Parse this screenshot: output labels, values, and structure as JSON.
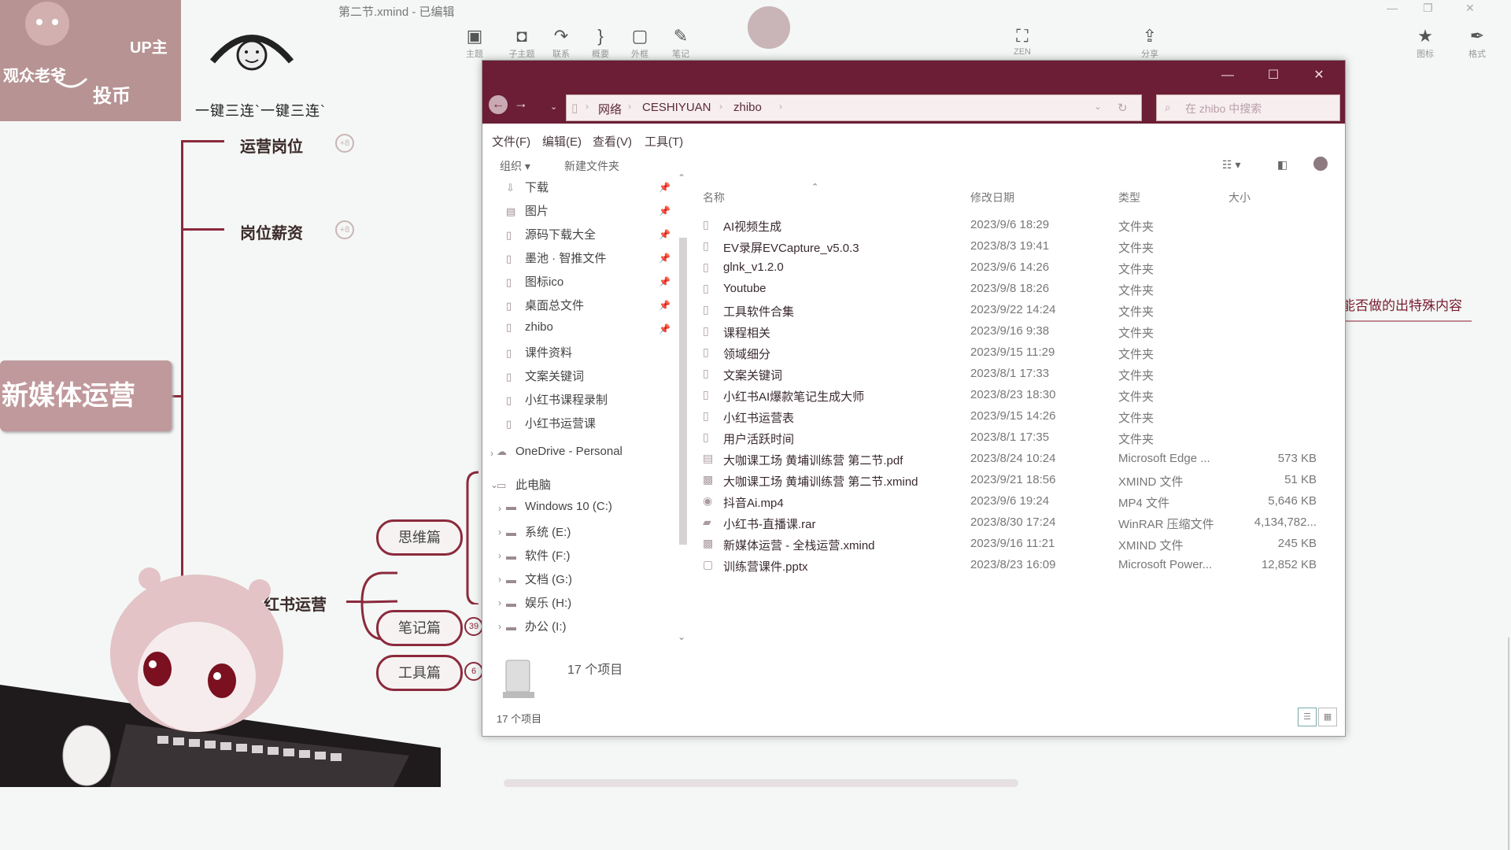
{
  "xmind": {
    "title": "第二节.xmind - 已编辑",
    "toolbar": [
      {
        "label": "主题",
        "icon": "topic-icon"
      },
      {
        "label": "子主题",
        "icon": "subtopic-icon"
      },
      {
        "label": "联系",
        "icon": "relationship-icon"
      },
      {
        "label": "概要",
        "icon": "summary-icon"
      },
      {
        "label": "外框",
        "icon": "boundary-icon"
      },
      {
        "label": "笔记",
        "icon": "note-icon"
      },
      {
        "label": "ZEN",
        "icon": "zen-icon"
      },
      {
        "label": "分享",
        "icon": "share-icon"
      },
      {
        "label": "图标",
        "icon": "star-icon"
      },
      {
        "label": "格式",
        "icon": "pen-icon"
      }
    ],
    "stickers": {
      "audience": "观众老爷",
      "up_host": "UP主",
      "coin": "投币",
      "triple": "一键三连`一键三连`"
    },
    "topics": {
      "central": "新媒体运营",
      "job_position": "运营岗位",
      "salary": "岗位薪资",
      "branch": "红书运营",
      "thinking": "思维篇",
      "notes": "笔记篇",
      "tools": "工具篇"
    },
    "badges": {
      "position": "+8",
      "salary": "+8",
      "notes": "39",
      "tools": "6"
    },
    "right_note": "能否做的出特殊内容"
  },
  "explorer": {
    "breadcrumb": [
      "网络",
      "CESHIYUAN",
      "zhibo"
    ],
    "search_placeholder": "在 zhibo 中搜索",
    "menus": [
      "文件(F)",
      "编辑(E)",
      "查看(V)",
      "工具(T)"
    ],
    "commands": {
      "organize": "组织 ▾",
      "new_folder": "新建文件夹"
    },
    "quick_access": [
      {
        "label": "下载",
        "icon": "download-icon",
        "pinned": true
      },
      {
        "label": "图片",
        "icon": "picture-icon",
        "pinned": true
      },
      {
        "label": "源码下载大全",
        "icon": "folder-icon",
        "pinned": true
      },
      {
        "label": "墨池 · 智推文件",
        "icon": "folder-icon",
        "pinned": true
      },
      {
        "label": "图标ico",
        "icon": "folder-icon",
        "pinned": true
      },
      {
        "label": "桌面总文件",
        "icon": "folder-icon",
        "pinned": true
      },
      {
        "label": "zhibo",
        "icon": "folder-icon",
        "pinned": true
      },
      {
        "label": "课件资料",
        "icon": "folder-icon",
        "pinned": false
      },
      {
        "label": "文案关键词",
        "icon": "folder-icon",
        "pinned": false
      },
      {
        "label": "小红书课程录制",
        "icon": "folder-icon",
        "pinned": false
      },
      {
        "label": "小红书运营课",
        "icon": "folder-icon",
        "pinned": false
      }
    ],
    "onedrive": "OneDrive - Personal",
    "this_pc": "此电脑",
    "drives": [
      "Windows 10 (C:)",
      "系统 (E:)",
      "软件 (F:)",
      "文档 (G:)",
      "娱乐 (H:)",
      "办公 (I:)"
    ],
    "columns": {
      "name": "名称",
      "date": "修改日期",
      "type": "类型",
      "size": "大小"
    },
    "files": [
      {
        "name": "AI视频生成",
        "date": "2023/9/6 18:29",
        "type": "文件夹",
        "size": "",
        "icon": "folder-icon"
      },
      {
        "name": "EV录屏EVCapture_v5.0.3",
        "date": "2023/8/3 19:41",
        "type": "文件夹",
        "size": "",
        "icon": "folder-icon"
      },
      {
        "name": "glnk_v1.2.0",
        "date": "2023/9/6 14:26",
        "type": "文件夹",
        "size": "",
        "icon": "folder-icon"
      },
      {
        "name": "Youtube",
        "date": "2023/9/8 18:26",
        "type": "文件夹",
        "size": "",
        "icon": "folder-icon"
      },
      {
        "name": "工具软件合集",
        "date": "2023/9/22 14:24",
        "type": "文件夹",
        "size": "",
        "icon": "folder-icon"
      },
      {
        "name": "课程相关",
        "date": "2023/9/16 9:38",
        "type": "文件夹",
        "size": "",
        "icon": "folder-icon"
      },
      {
        "name": "领域细分",
        "date": "2023/9/15 11:29",
        "type": "文件夹",
        "size": "",
        "icon": "folder-icon"
      },
      {
        "name": "文案关键词",
        "date": "2023/8/1 17:33",
        "type": "文件夹",
        "size": "",
        "icon": "folder-icon"
      },
      {
        "name": "小红书AI爆款笔记生成大师",
        "date": "2023/8/23 18:30",
        "type": "文件夹",
        "size": "",
        "icon": "folder-icon"
      },
      {
        "name": "小红书运营表",
        "date": "2023/9/15 14:26",
        "type": "文件夹",
        "size": "",
        "icon": "folder-icon"
      },
      {
        "name": "用户活跃时间",
        "date": "2023/8/1 17:35",
        "type": "文件夹",
        "size": "",
        "icon": "folder-icon"
      },
      {
        "name": "大咖课工场 黄埔训练营 第二节.pdf",
        "date": "2023/8/24 10:24",
        "type": "Microsoft Edge ...",
        "size": "573 KB",
        "icon": "pdf-icon"
      },
      {
        "name": "大咖课工场 黄埔训练营 第二节.xmind",
        "date": "2023/9/21 18:56",
        "type": "XMIND 文件",
        "size": "51 KB",
        "icon": "xmind-icon"
      },
      {
        "name": "抖音Ai.mp4",
        "date": "2023/9/6 19:24",
        "type": "MP4 文件",
        "size": "5,646 KB",
        "icon": "video-icon"
      },
      {
        "name": "小红书-直播课.rar",
        "date": "2023/8/30 17:24",
        "type": "WinRAR 压缩文件",
        "size": "4,134,782...",
        "icon": "archive-icon"
      },
      {
        "name": "新媒体运营 - 全栈运营.xmind",
        "date": "2023/9/16 11:21",
        "type": "XMIND 文件",
        "size": "245 KB",
        "icon": "xmind-icon"
      },
      {
        "name": "训练营课件.pptx",
        "date": "2023/8/23 16:09",
        "type": "Microsoft Power...",
        "size": "12,852 KB",
        "icon": "file-icon"
      }
    ],
    "item_count_pane": "17 个项目",
    "status_text": "17 个项目"
  }
}
